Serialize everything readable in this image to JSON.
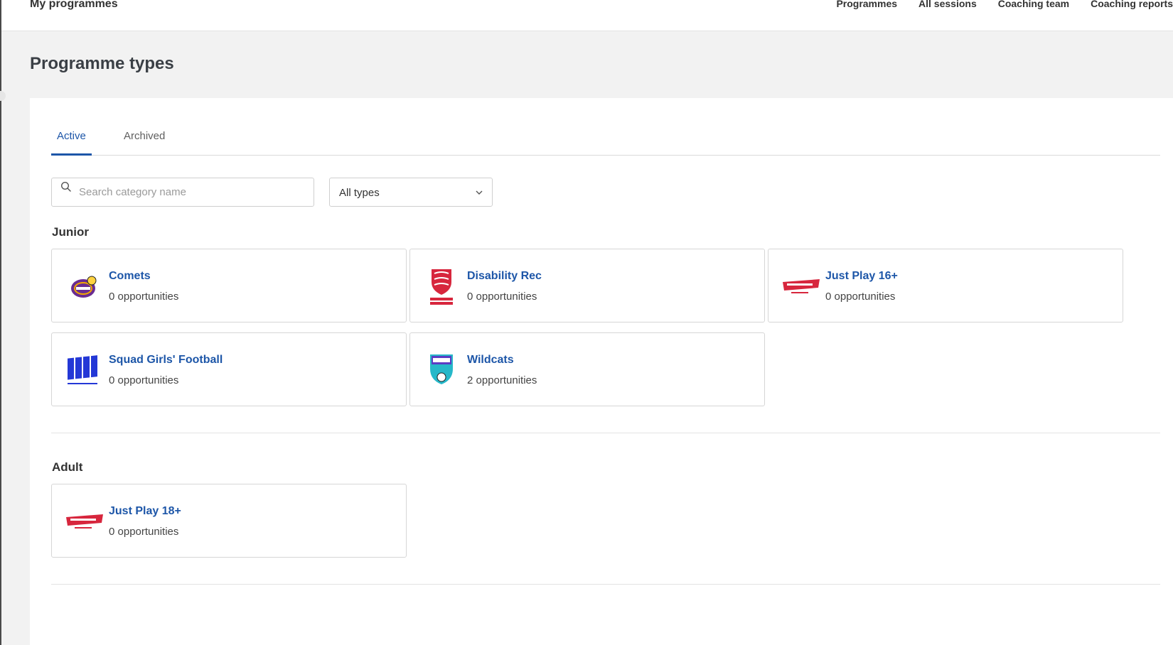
{
  "header": {
    "brand": "My programmes",
    "nav": [
      "Programmes",
      "All sessions",
      "Coaching team",
      "Coaching reports"
    ]
  },
  "page": {
    "title": "Programme types"
  },
  "tabs": [
    {
      "label": "Active",
      "active": true
    },
    {
      "label": "Archived",
      "active": false
    }
  ],
  "filters": {
    "search_placeholder": "Search category name",
    "type_selected": "All types"
  },
  "sections": [
    {
      "title": "Junior",
      "cards": [
        {
          "name": "Comets",
          "opportunities": "0 opportunities",
          "logo": "comets-logo"
        },
        {
          "name": "Disability Rec",
          "opportunities": "0 opportunities",
          "logo": "england-football-logo"
        },
        {
          "name": "Just Play 16+",
          "opportunities": "0 opportunities",
          "logo": "just-play-logo"
        },
        {
          "name": "Squad Girls' Football",
          "opportunities": "0 opportunities",
          "logo": "squad-logo"
        },
        {
          "name": "Wildcats",
          "opportunities": "2 opportunities",
          "logo": "wildcats-logo"
        }
      ]
    },
    {
      "title": "Adult",
      "cards": [
        {
          "name": "Just Play 18+",
          "opportunities": "0 opportunities",
          "logo": "just-play-logo"
        }
      ]
    }
  ],
  "colors": {
    "accent": "#1d56a8",
    "background": "#f2f2f2",
    "logo_red": "#d7263d"
  }
}
